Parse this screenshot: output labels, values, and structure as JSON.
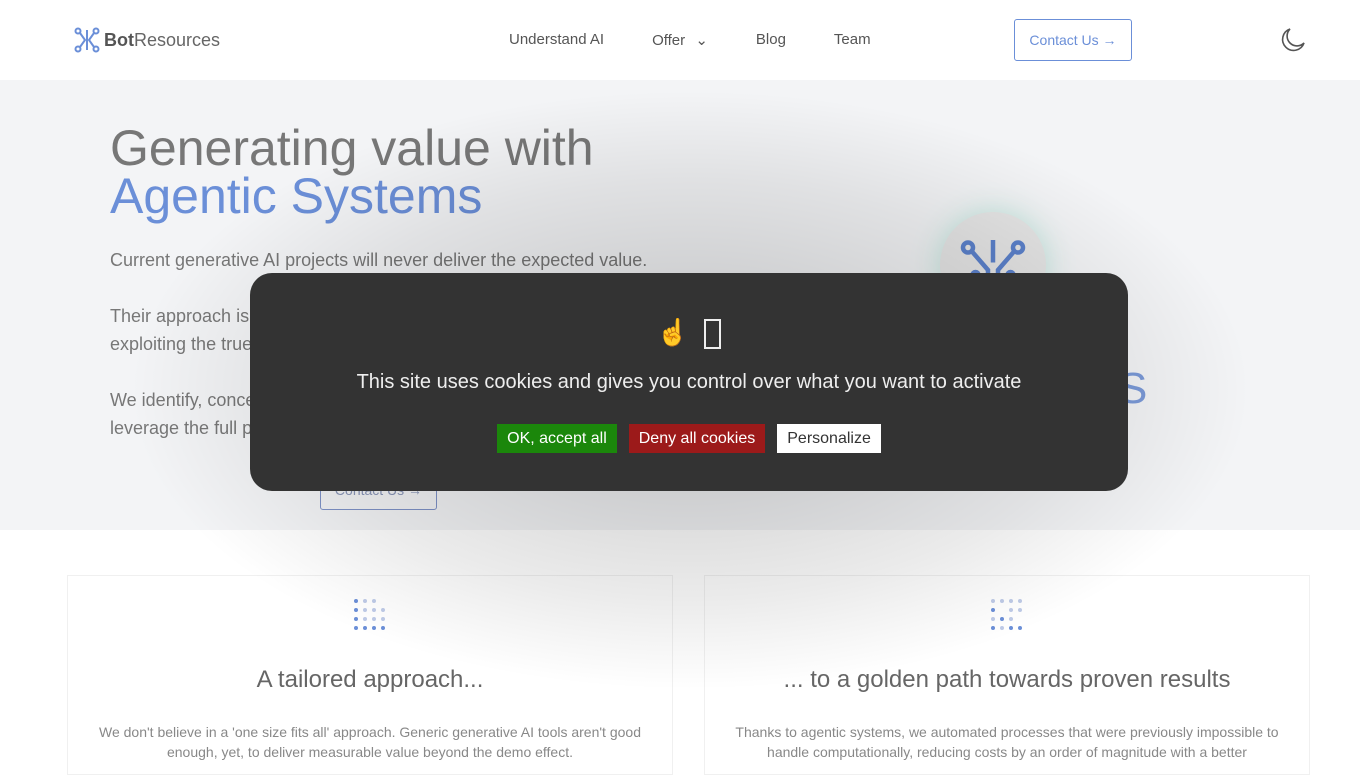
{
  "nav": {
    "brand_bold": "Bot",
    "brand_rest": "Resources",
    "links": [
      "Understand AI",
      "Offer",
      "Blog",
      "Team"
    ],
    "contact": "Contact Us →",
    "theme_icon": "moon-icon"
  },
  "hero": {
    "title_line1": "Generating value with",
    "title_line2": "Agentic Systems",
    "p1": "Current generative AI projects will never deliver the expected value.",
    "p2a": "Their approach is",
    "p2b": "exploiting the true",
    "p3a": "We identify, conce",
    "p3b": "leverage the full p",
    "button": "Contact Us →",
    "heading_fragment": "S"
  },
  "cards": [
    {
      "title": "A tailored approach...",
      "text": "We don't believe in a 'one size fits all' approach. Generic generative AI tools aren't good enough, yet, to deliver measurable value beyond the demo effect."
    },
    {
      "title": "... to a golden path towards proven results",
      "text": "Thanks to agentic systems, we automated processes that were previously impossible to handle computationally, reducing costs by an order of magnitude with a better"
    }
  ],
  "cookie": {
    "message": "This site uses cookies and gives you control over what you want to activate",
    "accept": "OK, accept all",
    "deny": "Deny all cookies",
    "personalize": "Personalize",
    "icon_glyph": "☝"
  },
  "colors": {
    "accent": "#6b8fd8",
    "accept": "#1b870b",
    "deny": "#9c1a1a",
    "modal": "#333333"
  }
}
